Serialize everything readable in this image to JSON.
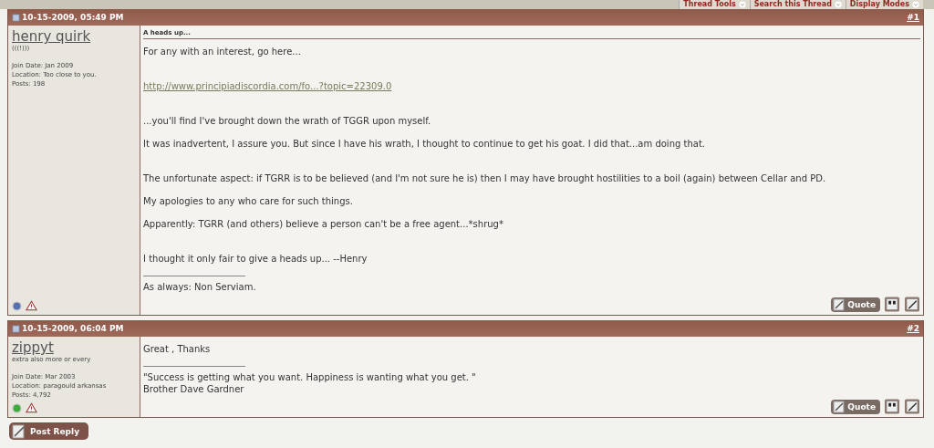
{
  "toolbar": [
    {
      "label": "Thread Tools"
    },
    {
      "label": "Search this Thread"
    },
    {
      "label": "Display Modes"
    }
  ],
  "posts": [
    {
      "date": "10-15-2009, 05:49 PM",
      "number": "#1",
      "user": {
        "name": "henry quirk",
        "title": "(((!)))",
        "join_date": "Join Date: Jan 2009",
        "location": "Location: Too close to you.",
        "posts": "Posts: 198",
        "online": false
      },
      "subject": "A heads up...",
      "blocks": [
        {
          "paragraphs": [
            {
              "kind": "text",
              "text": "For any with an interest, go here..."
            }
          ]
        },
        {
          "paragraphs": [
            {
              "kind": "link",
              "text": "http://www.principiadiscordia.com/fo...?topic=22309.0"
            }
          ]
        },
        {
          "paragraphs": [
            {
              "kind": "text",
              "text": "...you'll find I've brought down the wrath of TGGR upon myself."
            },
            {
              "kind": "text",
              "text": "It was inadvertent, I assure you. But since I have his wrath, I thought to continue to get his goat. I did that...am doing that."
            }
          ]
        },
        {
          "paragraphs": [
            {
              "kind": "text",
              "text": "The unfortunate aspect: if TGRR is to be believed (and I'm not sure he is) then I may have brought hostilities to a boil (again) between Cellar and PD."
            },
            {
              "kind": "text",
              "text": "My apologies to any who care for such things."
            },
            {
              "kind": "text",
              "text": "Apparently: TGRR (and others) believe a person can't be a free agent...*shrug*"
            }
          ]
        },
        {
          "paragraphs": [
            {
              "kind": "text",
              "text": "I thought it only fair to give a heads up... --Henry"
            }
          ]
        }
      ],
      "signature": [
        "As always: Non Serviam."
      ],
      "quote_button": "Quote"
    },
    {
      "date": "10-15-2009, 06:04 PM",
      "number": "#2",
      "user": {
        "name": "zippyt",
        "title": "extra also more or every",
        "join_date": "Join Date: Mar 2003",
        "location": "Location: paragould arkansas",
        "posts": "Posts: 4,792",
        "online": true
      },
      "blocks": [
        {
          "paragraphs": [
            {
              "kind": "text",
              "text": "Great , Thanks"
            }
          ]
        }
      ],
      "signature": [
        "\"Success is getting what you want. Happiness is wanting what you get. \"",
        "Brother Dave Gardner"
      ],
      "quote_button": "Quote"
    }
  ],
  "reply_button": "Post Reply"
}
